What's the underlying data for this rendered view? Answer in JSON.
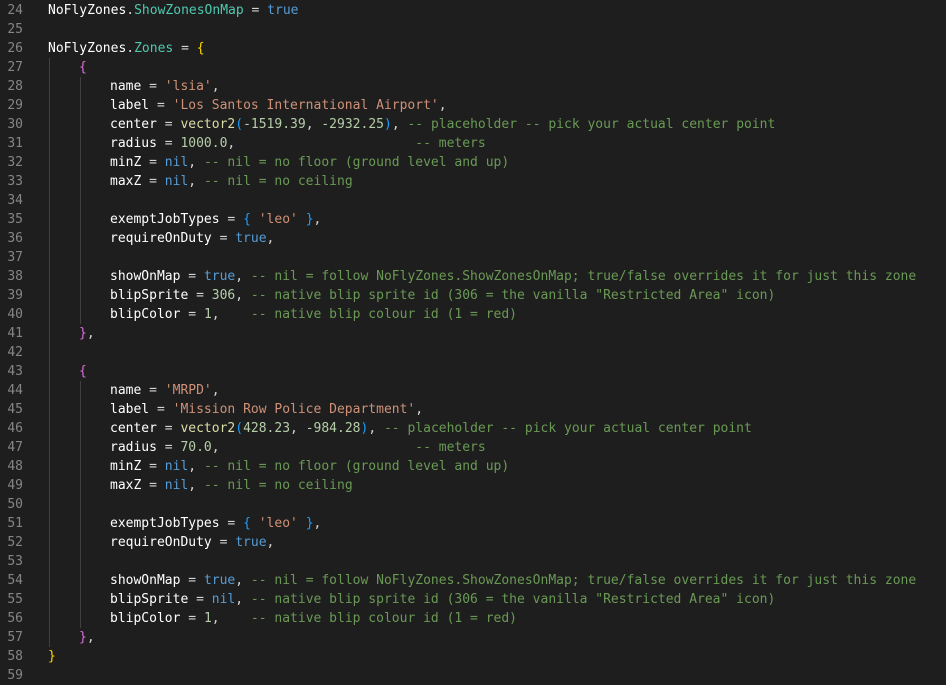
{
  "editor": {
    "language": "lua",
    "lines": [
      {
        "n": "24",
        "indent": 0,
        "tokens": [
          [
            "NoFlyZones",
            "k"
          ],
          [
            ".",
            "o"
          ],
          [
            "ShowZonesOnMap",
            "p"
          ],
          [
            " = ",
            "o"
          ],
          [
            "true",
            "b"
          ]
        ]
      },
      {
        "n": "25",
        "indent": 0,
        "tokens": []
      },
      {
        "n": "26",
        "indent": 0,
        "tokens": [
          [
            "NoFlyZones",
            "k"
          ],
          [
            ".",
            "o"
          ],
          [
            "Zones",
            "p"
          ],
          [
            " = ",
            "o"
          ],
          [
            "{",
            "y"
          ]
        ]
      },
      {
        "n": "27",
        "indent": 1,
        "tokens": [
          [
            "{",
            "m"
          ]
        ]
      },
      {
        "n": "28",
        "indent": 2,
        "tokens": [
          [
            "name",
            "k"
          ],
          [
            " = ",
            "o"
          ],
          [
            "'lsia'",
            "s"
          ],
          [
            ",",
            "o"
          ]
        ]
      },
      {
        "n": "29",
        "indent": 2,
        "tokens": [
          [
            "label",
            "k"
          ],
          [
            " = ",
            "o"
          ],
          [
            "'Los Santos International Airport'",
            "s"
          ],
          [
            ",",
            "o"
          ]
        ]
      },
      {
        "n": "30",
        "indent": 2,
        "tokens": [
          [
            "center",
            "k"
          ],
          [
            " = ",
            "o"
          ],
          [
            "vector2",
            "f"
          ],
          [
            "(",
            "x"
          ],
          [
            "-1519.39",
            "n"
          ],
          [
            ", ",
            "o"
          ],
          [
            "-2932.25",
            "n"
          ],
          [
            ")",
            "x"
          ],
          [
            ", ",
            "o"
          ],
          [
            "-- placeholder -- pick your actual center point",
            "c"
          ]
        ]
      },
      {
        "n": "31",
        "indent": 2,
        "tokens": [
          [
            "radius",
            "k"
          ],
          [
            " = ",
            "o"
          ],
          [
            "1000.0",
            "n"
          ],
          [
            ",",
            "o"
          ],
          [
            "                       ",
            "o"
          ],
          [
            "-- meters",
            "c"
          ]
        ]
      },
      {
        "n": "32",
        "indent": 2,
        "tokens": [
          [
            "minZ",
            "k"
          ],
          [
            " = ",
            "o"
          ],
          [
            "nil",
            "b"
          ],
          [
            ", ",
            "o"
          ],
          [
            "-- nil = no floor (ground level and up)",
            "c"
          ]
        ]
      },
      {
        "n": "33",
        "indent": 2,
        "tokens": [
          [
            "maxZ",
            "k"
          ],
          [
            " = ",
            "o"
          ],
          [
            "nil",
            "b"
          ],
          [
            ", ",
            "o"
          ],
          [
            "-- nil = no ceiling",
            "c"
          ]
        ]
      },
      {
        "n": "34",
        "indent": 2,
        "tokens": []
      },
      {
        "n": "35",
        "indent": 2,
        "tokens": [
          [
            "exemptJobTypes",
            "k"
          ],
          [
            " = ",
            "o"
          ],
          [
            "{",
            "x"
          ],
          [
            " ",
            "o"
          ],
          [
            "'leo'",
            "s"
          ],
          [
            " ",
            "o"
          ],
          [
            "}",
            "x"
          ],
          [
            ",",
            "o"
          ]
        ]
      },
      {
        "n": "36",
        "indent": 2,
        "tokens": [
          [
            "requireOnDuty",
            "k"
          ],
          [
            " = ",
            "o"
          ],
          [
            "true",
            "b"
          ],
          [
            ",",
            "o"
          ]
        ]
      },
      {
        "n": "37",
        "indent": 2,
        "tokens": []
      },
      {
        "n": "38",
        "indent": 2,
        "tokens": [
          [
            "showOnMap",
            "k"
          ],
          [
            " = ",
            "o"
          ],
          [
            "true",
            "b"
          ],
          [
            ", ",
            "o"
          ],
          [
            "-- nil = follow NoFlyZones.ShowZonesOnMap; true/false overrides it for just this zone",
            "c"
          ]
        ]
      },
      {
        "n": "39",
        "indent": 2,
        "tokens": [
          [
            "blipSprite",
            "k"
          ],
          [
            " = ",
            "o"
          ],
          [
            "306",
            "n"
          ],
          [
            ", ",
            "o"
          ],
          [
            "-- native blip sprite id (306 = the vanilla \"Restricted Area\" icon)",
            "c"
          ]
        ]
      },
      {
        "n": "40",
        "indent": 2,
        "tokens": [
          [
            "blipColor",
            "k"
          ],
          [
            " = ",
            "o"
          ],
          [
            "1",
            "n"
          ],
          [
            ",    ",
            "o"
          ],
          [
            "-- native blip colour id (1 = red)",
            "c"
          ]
        ]
      },
      {
        "n": "41",
        "indent": 1,
        "tokens": [
          [
            "}",
            "m"
          ],
          [
            ",",
            "o"
          ]
        ]
      },
      {
        "n": "42",
        "indent": 1,
        "tokens": []
      },
      {
        "n": "43",
        "indent": 1,
        "tokens": [
          [
            "{",
            "m"
          ]
        ]
      },
      {
        "n": "44",
        "indent": 2,
        "tokens": [
          [
            "name",
            "k"
          ],
          [
            " = ",
            "o"
          ],
          [
            "'MRPD'",
            "s"
          ],
          [
            ",",
            "o"
          ]
        ]
      },
      {
        "n": "45",
        "indent": 2,
        "tokens": [
          [
            "label",
            "k"
          ],
          [
            " = ",
            "o"
          ],
          [
            "'Mission Row Police Department'",
            "s"
          ],
          [
            ",",
            "o"
          ]
        ]
      },
      {
        "n": "46",
        "indent": 2,
        "tokens": [
          [
            "center",
            "k"
          ],
          [
            " = ",
            "o"
          ],
          [
            "vector2",
            "f"
          ],
          [
            "(",
            "x"
          ],
          [
            "428.23",
            "n"
          ],
          [
            ", ",
            "o"
          ],
          [
            "-984.28",
            "n"
          ],
          [
            ")",
            "x"
          ],
          [
            ", ",
            "o"
          ],
          [
            "-- placeholder -- pick your actual center point",
            "c"
          ]
        ]
      },
      {
        "n": "47",
        "indent": 2,
        "tokens": [
          [
            "radius",
            "k"
          ],
          [
            " = ",
            "o"
          ],
          [
            "70.0",
            "n"
          ],
          [
            ",",
            "o"
          ],
          [
            "                         ",
            "o"
          ],
          [
            "-- meters",
            "c"
          ]
        ]
      },
      {
        "n": "48",
        "indent": 2,
        "tokens": [
          [
            "minZ",
            "k"
          ],
          [
            " = ",
            "o"
          ],
          [
            "nil",
            "b"
          ],
          [
            ", ",
            "o"
          ],
          [
            "-- nil = no floor (ground level and up)",
            "c"
          ]
        ]
      },
      {
        "n": "49",
        "indent": 2,
        "tokens": [
          [
            "maxZ",
            "k"
          ],
          [
            " = ",
            "o"
          ],
          [
            "nil",
            "b"
          ],
          [
            ", ",
            "o"
          ],
          [
            "-- nil = no ceiling",
            "c"
          ]
        ]
      },
      {
        "n": "50",
        "indent": 2,
        "tokens": []
      },
      {
        "n": "51",
        "indent": 2,
        "tokens": [
          [
            "exemptJobTypes",
            "k"
          ],
          [
            " = ",
            "o"
          ],
          [
            "{",
            "x"
          ],
          [
            " ",
            "o"
          ],
          [
            "'leo'",
            "s"
          ],
          [
            " ",
            "o"
          ],
          [
            "}",
            "x"
          ],
          [
            ",",
            "o"
          ]
        ]
      },
      {
        "n": "52",
        "indent": 2,
        "tokens": [
          [
            "requireOnDuty",
            "k"
          ],
          [
            " = ",
            "o"
          ],
          [
            "true",
            "b"
          ],
          [
            ",",
            "o"
          ]
        ]
      },
      {
        "n": "53",
        "indent": 2,
        "tokens": []
      },
      {
        "n": "54",
        "indent": 2,
        "tokens": [
          [
            "showOnMap",
            "k"
          ],
          [
            " = ",
            "o"
          ],
          [
            "true",
            "b"
          ],
          [
            ", ",
            "o"
          ],
          [
            "-- nil = follow NoFlyZones.ShowZonesOnMap; true/false overrides it for just this zone",
            "c"
          ]
        ]
      },
      {
        "n": "55",
        "indent": 2,
        "tokens": [
          [
            "blipSprite",
            "k"
          ],
          [
            " = ",
            "o"
          ],
          [
            "nil",
            "b"
          ],
          [
            ", ",
            "o"
          ],
          [
            "-- native blip sprite id (306 = the vanilla \"Restricted Area\" icon)",
            "c"
          ]
        ]
      },
      {
        "n": "56",
        "indent": 2,
        "tokens": [
          [
            "blipColor",
            "k"
          ],
          [
            " = ",
            "o"
          ],
          [
            "1",
            "n"
          ],
          [
            ",    ",
            "o"
          ],
          [
            "-- native blip colour id (1 = red)",
            "c"
          ]
        ]
      },
      {
        "n": "57",
        "indent": 1,
        "tokens": [
          [
            "}",
            "m"
          ],
          [
            ",",
            "o"
          ]
        ]
      },
      {
        "n": "58",
        "indent": 0,
        "tokens": [
          [
            "}",
            "y"
          ]
        ]
      },
      {
        "n": "59",
        "indent": 0,
        "tokens": []
      }
    ]
  }
}
